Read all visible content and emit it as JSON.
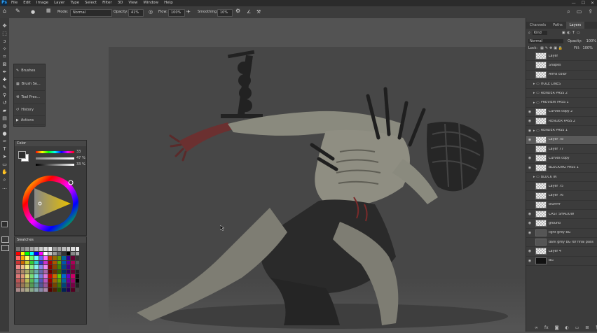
{
  "app": {
    "logo": "Ps"
  },
  "menu": [
    "File",
    "Edit",
    "Image",
    "Layer",
    "Type",
    "Select",
    "Filter",
    "3D",
    "View",
    "Window",
    "Help"
  ],
  "window_controls": [
    "—",
    "☐",
    "✕"
  ],
  "options_bar": {
    "mode_label": "Mode:",
    "mode_value": "Normal",
    "opacity_label": "Opacity:",
    "opacity_value": "41%",
    "flow_label": "Flow:",
    "flow_value": "100%",
    "smoothing_label": "Smoothing:",
    "smoothing_value": "10%"
  },
  "tools": [
    "move-tool-icon",
    "marquee-tool-icon",
    "lasso-tool-icon",
    "quick-select-icon",
    "crop-tool-icon",
    "frame-tool-icon",
    "eyedropper-icon",
    "healing-brush-icon",
    "brush-tool-icon",
    "clone-stamp-icon",
    "history-brush-icon",
    "eraser-icon",
    "gradient-icon",
    "blur-icon",
    "dodge-icon",
    "pen-tool-icon",
    "type-tool-icon",
    "path-select-icon",
    "rectangle-tool-icon",
    "hand-tool-icon",
    "zoom-tool-icon",
    "more-tools-icon"
  ],
  "history_panel": {
    "items": [
      {
        "icon": "brushes-icon",
        "label": "Brushes"
      },
      {
        "icon": "brush-settings-icon",
        "label": "Brush Se..."
      },
      {
        "icon": "tool-presets-icon",
        "label": "Tool Pres..."
      },
      {
        "icon": "history-icon",
        "label": "History"
      },
      {
        "icon": "actions-icon",
        "label": "Actions"
      }
    ]
  },
  "color_panel": {
    "title": "Color",
    "values": [
      "33",
      "47",
      "33"
    ],
    "units": [
      "",
      "%",
      "%"
    ],
    "foreground": "#2e2e2e",
    "background": "#ffffff"
  },
  "swatches_panel": {
    "title": "Swatches"
  },
  "layers_panel": {
    "tabs": [
      "Channels",
      "Paths",
      "Layers"
    ],
    "active_tab": "Layers",
    "filter_label": "Kind",
    "blend_mode": "Normal",
    "opacity_label": "Opacity:",
    "opacity_value": "100%",
    "lock_label": "Lock:",
    "fill_label": "Fill:",
    "fill_value": "100%",
    "layers": [
      {
        "name": "Layer",
        "type": "layer",
        "visible": false
      },
      {
        "name": "Shapes",
        "type": "layer",
        "visible": false
      },
      {
        "name": "Arms color",
        "type": "layer",
        "visible": false
      },
      {
        "name": "HOLE LINES",
        "type": "group",
        "visible": false
      },
      {
        "name": "RENDER PASS 2",
        "type": "group",
        "visible": false
      },
      {
        "name": "PREVIEW PASS 1",
        "type": "group",
        "visible": false
      },
      {
        "name": "Curves copy 2",
        "type": "adjustment",
        "visible": true
      },
      {
        "name": "RENDER PASS 2",
        "type": "layer",
        "visible": true
      },
      {
        "name": "RENDER PASS 1",
        "type": "group",
        "visible": true
      },
      {
        "name": "Layer 78",
        "type": "layer",
        "visible": true,
        "selected": true
      },
      {
        "name": "Layer 77",
        "type": "layer",
        "visible": false
      },
      {
        "name": "Curves copy",
        "type": "adjustment",
        "visible": true
      },
      {
        "name": "BLOCKING PASS 1",
        "type": "layer",
        "visible": true
      },
      {
        "name": "BLOCK IN",
        "type": "group",
        "visible": false
      },
      {
        "name": "Layer 75",
        "type": "layer",
        "visible": false
      },
      {
        "name": "Layer 76",
        "type": "layer",
        "visible": false
      },
      {
        "name": "blurrrrr",
        "type": "layer",
        "visible": false
      },
      {
        "name": "CAST SHADOW",
        "type": "layer",
        "visible": true
      },
      {
        "name": "ground",
        "type": "layer",
        "visible": true
      },
      {
        "name": "light grey BG",
        "type": "layer",
        "visible": true
      },
      {
        "name": "dark grey BG for final pass",
        "type": "layer",
        "visible": false
      },
      {
        "name": "Layer 4",
        "type": "layer",
        "visible": true
      },
      {
        "name": "BG",
        "type": "layer",
        "visible": true
      }
    ]
  },
  "colors": {
    "ui_dark": "#2b2b2b",
    "panel": "#3c3c3c",
    "workspace": "#535353",
    "canvas": "#474747",
    "figure": "#8a8a7e",
    "blood": "#7a2a2a"
  }
}
